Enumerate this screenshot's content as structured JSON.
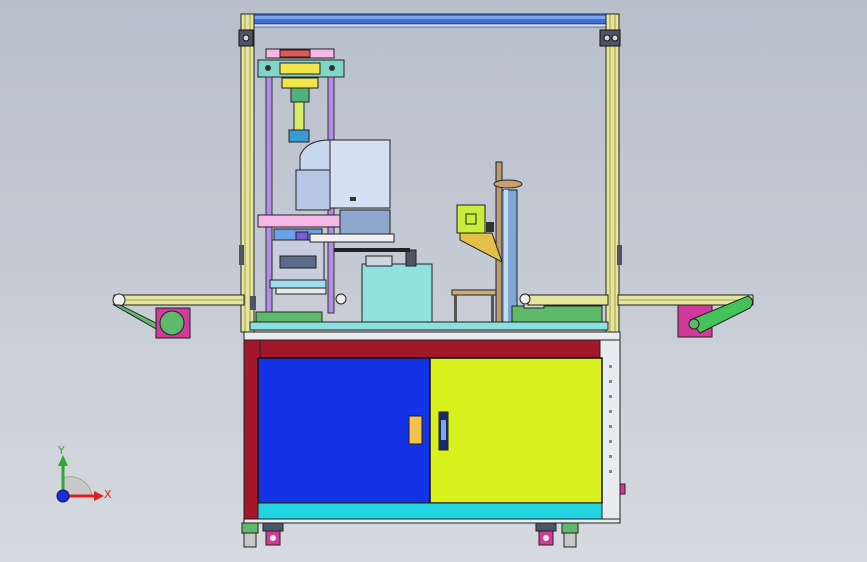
{
  "viewport": {
    "background_top": "#b7bfcc",
    "background_bottom": "#d6dae0"
  },
  "triad": {
    "y_label": "Y",
    "x_label": "X",
    "y_color": "#2ea836",
    "x_color": "#e02020",
    "z_color": "#1a2fd6"
  },
  "colors": {
    "frame_yellow": "#e6e69a",
    "cabinet_red": "#a3172b",
    "door_left": "#1533e6",
    "door_right": "#d8f01c",
    "plinth_cyan": "#22d3e0",
    "side_panel": "#e8ecef",
    "top_beam_blue": "#3f6fd6",
    "scara_body": "#c9d7ef",
    "pink": "#f5b8e6",
    "teal_block": "#8fe2e0",
    "magenta": "#d13a9a",
    "green_roller": "#44c35a",
    "purple_rod": "#b38ee6"
  }
}
